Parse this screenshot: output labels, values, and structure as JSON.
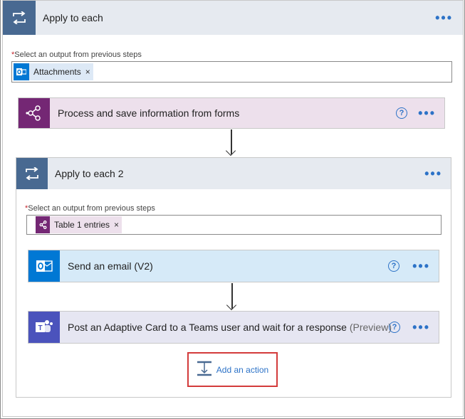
{
  "outer_loop": {
    "title": "Apply to each",
    "more": "•••",
    "field_required": "*",
    "field_label": "Select an output from previous steps",
    "token": {
      "label": "Attachments",
      "remove": "×"
    }
  },
  "process_action": {
    "title": "Process and save information from forms",
    "help": "?",
    "more": "•••"
  },
  "inner_loop": {
    "title": "Apply to each 2",
    "more": "•••",
    "field_required": "*",
    "field_label": "Select an output from previous steps",
    "token": {
      "label": "Table 1 entries",
      "remove": "×"
    }
  },
  "send_email_action": {
    "title": "Send an email (V2)",
    "help": "?",
    "more": "•••"
  },
  "teams_action": {
    "title": "Post an Adaptive Card to a Teams user and wait for a response",
    "suffix": "(Preview)",
    "help": "?",
    "more": "•••"
  },
  "add_action": {
    "label": "Add an action"
  },
  "colors": {
    "loop_tile": "#486991",
    "loop_header": "#e6eaf0",
    "ai_builder": "#742774",
    "ai_builder_bg": "#ede0ec",
    "outlook": "#0078d4",
    "outlook_bg": "#d6eaf8",
    "teams": "#4b53bc",
    "teams_bg": "#e6e6f2",
    "link": "#2c72c7",
    "highlight": "#d33b3b"
  }
}
